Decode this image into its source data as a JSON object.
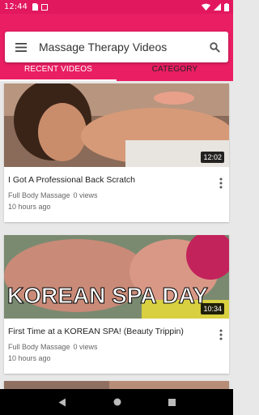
{
  "status": {
    "time": "12:44"
  },
  "header": {
    "title": "Massage Therapy Videos"
  },
  "tabs": [
    {
      "label": "RECENT VIDEOS"
    },
    {
      "label": "CATEGORY"
    }
  ],
  "videos": [
    {
      "title": "I Got A Professional Back Scratch",
      "channel": "Full Body Massage",
      "views": "0 views",
      "age": "10 hours ago",
      "duration": "12:02"
    },
    {
      "title": "First Time at a KOREAN SPA! (Beauty Trippin)",
      "channel": "Full Body Massage",
      "views": "0 views",
      "age": "10 hours ago",
      "duration": "10:34",
      "thumb_text": "KOREAN SPA DAY"
    }
  ],
  "colors": {
    "primary": "#e91e63",
    "status": "#e2185f"
  }
}
